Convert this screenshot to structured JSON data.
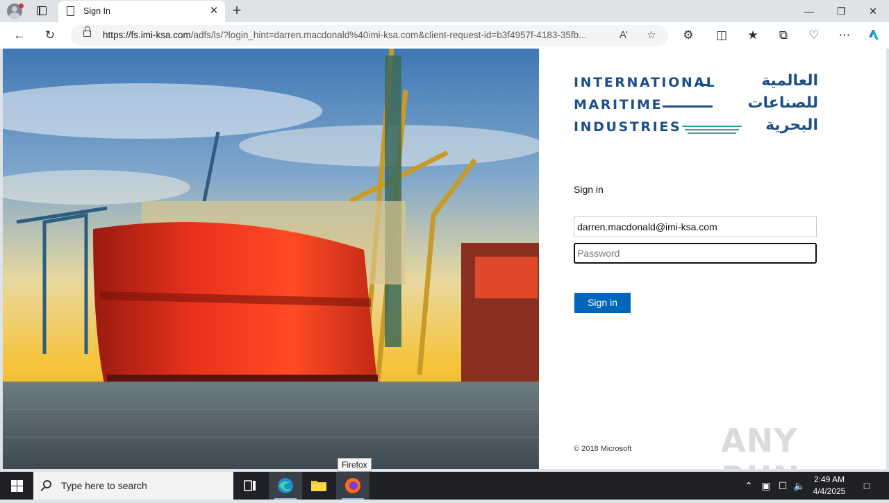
{
  "browser": {
    "tab_title": "Sign In",
    "new_tab": "+",
    "url_host": "https://fs.imi-ksa.com",
    "url_rest": "/adfs/ls/?login_hint=darren.macdonald%40imi-ksa.com&client-request-id=b3f4957f-4183-35fb..."
  },
  "logo": {
    "en_line1": "INTERNATIONAL",
    "en_line2": "MARITIME",
    "en_line3": "INDUSTRIES",
    "ar_line1": "العالمية",
    "ar_line2": "للصناعات",
    "ar_line3": "البحرية"
  },
  "signin": {
    "heading": "Sign in",
    "email_value": "darren.macdonald@imi-ksa.com",
    "password_placeholder": "Password",
    "button_label": "Sign in",
    "copyright": "© 2018 Microsoft"
  },
  "watermark": "ANY RUN",
  "tooltip": "Firefox",
  "taskbar": {
    "search_placeholder": "Type here to search",
    "time": "2:49 AM",
    "date": "4/4/2025"
  },
  "colors": {
    "brand_blue": "#1c4f87",
    "button_blue": "#0067b8",
    "accent_teal": "#2aa6a0"
  }
}
